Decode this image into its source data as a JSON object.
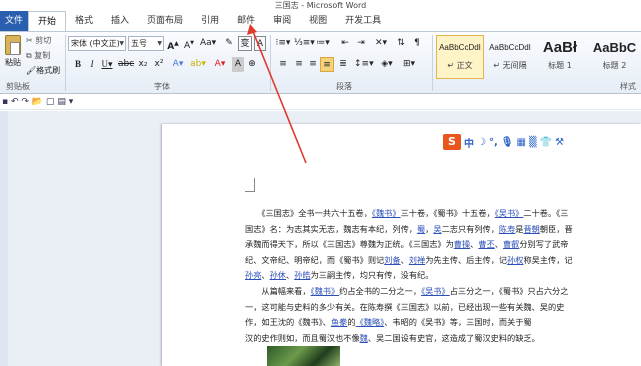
{
  "window": {
    "title": "三国志 - Microsoft Word"
  },
  "tabs": [
    {
      "label": "文件"
    },
    {
      "label": "开始"
    },
    {
      "label": "格式"
    },
    {
      "label": "插入"
    },
    {
      "label": "页面布局"
    },
    {
      "label": "引用"
    },
    {
      "label": "邮件"
    },
    {
      "label": "审阅"
    },
    {
      "label": "视图"
    },
    {
      "label": "开发工具"
    }
  ],
  "clipboard": {
    "paste": "粘贴",
    "cut": "剪切",
    "copy": "复制",
    "format_painter": "格式刷",
    "group": "剪贴板"
  },
  "font": {
    "name": "宋体 (中文正)",
    "size": "五号",
    "group": "字体"
  },
  "paragraph": {
    "group": "段落"
  },
  "styles": {
    "group": "样式",
    "items": [
      {
        "sample": "AaBbCcDdI",
        "name": "↵ 正文"
      },
      {
        "sample": "AaBbCcDdI",
        "name": "↵ 无间隔"
      },
      {
        "sample": "AaBł",
        "name": "标题 1"
      },
      {
        "sample": "AaBbC",
        "name": "标题 2"
      }
    ]
  },
  "ime": {
    "logo": "S",
    "items": [
      "中",
      "☽",
      "°,",
      "🎙",
      "▦",
      "▒",
      "👕",
      "⚒"
    ]
  },
  "document": {
    "lines": [
      [
        "　　《三国志》全书一共六十五卷，",
        {
          "t": "《魏书》",
          "l": 1
        },
        "三十卷，《蜀书》十五卷，",
        {
          "t": "《吴书》",
          "l": 1
        },
        "二十卷。《三"
      ],
      [
        "国志》名：为志其实无志，魏志有本纪，列传，",
        {
          "t": "蜀",
          "l": 1
        },
        "，",
        {
          "t": "吴",
          "l": 1
        },
        "二志只有列传，",
        {
          "t": "陈寿",
          "l": 1
        },
        "是",
        {
          "t": "晋朝",
          "l": 1
        },
        "朝臣，晋"
      ],
      [
        "承魏而得天下，所以《三国志》尊魏为正统。《三国志》为",
        {
          "t": "曹操",
          "l": 1
        },
        "、",
        {
          "t": "曹丕",
          "l": 1
        },
        "、",
        {
          "t": "曹叡",
          "l": 1
        },
        "分别写了武帝"
      ],
      [
        "纪、文帝纪、明帝纪，而《蜀书》则记",
        {
          "t": "刘备",
          "l": 1
        },
        "、",
        {
          "t": "刘禅",
          "l": 1
        },
        "为先主传、后主传，记",
        {
          "t": "孙权",
          "l": 1
        },
        "称吴主传，记"
      ],
      [
        {
          "t": "孙亮",
          "l": 1
        },
        "、",
        {
          "t": "孙休",
          "l": 1
        },
        "、",
        {
          "t": "孙皓",
          "l": 1
        },
        "为三嗣主传，均只有传，没有纪。"
      ],
      [
        "　　从篇幅来看，",
        {
          "t": "《魏书》",
          "l": 1
        },
        "约占全书的二分之一，",
        {
          "t": "《吴书》",
          "l": 1
        },
        "占三分之一，《蜀书》只占六分之"
      ],
      [
        "一，这可能与史料的多少有关。在陈寿撰《三国志》以前，已经出现一些有关魏、吴的史"
      ],
      [
        "作，如王沈的《魏书》、",
        {
          "t": "鱼豢",
          "l": 1
        },
        "的",
        {
          "t": "《魏略》",
          "l": 1
        },
        "、韦昭的《吴书》等，三国时，而关于蜀"
      ],
      [
        "汉的史作则如，而且蜀汉也不像",
        {
          "t": "魏",
          "l": 1
        },
        "、吴二国设有史官，这造成了蜀汉史料的缺乏。"
      ]
    ]
  }
}
